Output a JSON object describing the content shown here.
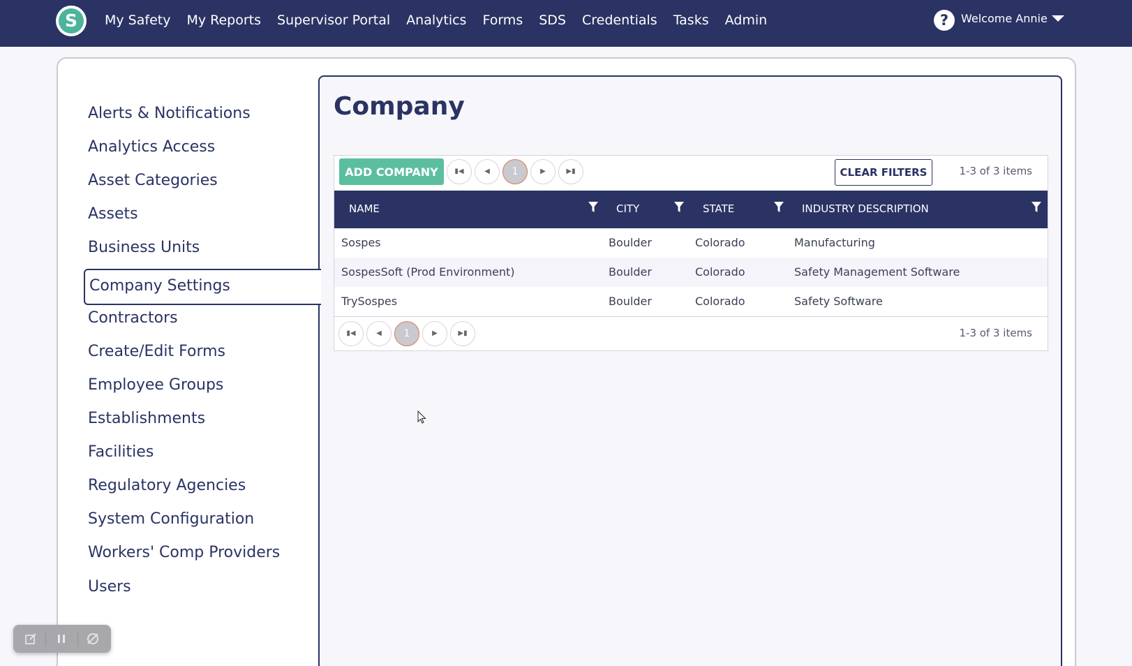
{
  "app": {
    "logo_letter": "S",
    "brand_color": "#2a3363",
    "accent_color": "#5bbf9f"
  },
  "nav": {
    "items": [
      "My Safety",
      "My Reports",
      "Supervisor Portal",
      "Analytics",
      "Forms",
      "SDS",
      "Credentials",
      "Tasks",
      "Admin"
    ],
    "help_icon": "question-circle-icon",
    "welcome": "Welcome Annie",
    "caret_icon": "caret-down-icon"
  },
  "sidebar": {
    "items": [
      "Alerts & Notifications",
      "Analytics Access",
      "Asset Categories",
      "Assets",
      "Business Units",
      "Company Settings",
      "Contractors",
      "Create/Edit Forms",
      "Employee Groups",
      "Establishments",
      "Facilities",
      "Regulatory Agencies",
      "System Configuration",
      "Workers' Comp Providers",
      "Users"
    ],
    "active": "Company Settings"
  },
  "main": {
    "title": "Company",
    "toolbar": {
      "add_label": "ADD COMPANY",
      "clear_label": "CLEAR FILTERS",
      "current_page": "1",
      "items_count": "1-3 of 3 items"
    },
    "columns": [
      "NAME",
      "CITY",
      "STATE",
      "INDUSTRY DESCRIPTION"
    ],
    "rows": [
      [
        "Sospes",
        "Boulder",
        "Colorado",
        "Manufacturing"
      ],
      [
        "SospesSoft (Prod Environment)",
        "Boulder",
        "Colorado",
        "Safety Management Software"
      ],
      [
        "TrySospes",
        "Boulder",
        "Colorado",
        "Safety Software"
      ]
    ],
    "footer": {
      "current_page": "1",
      "items_count": "1-3 of 3 items"
    }
  }
}
